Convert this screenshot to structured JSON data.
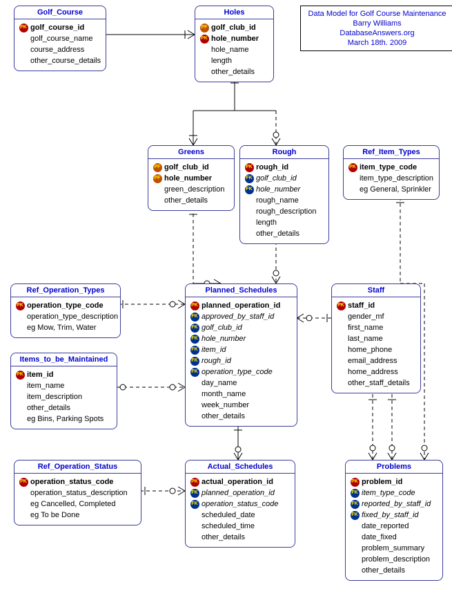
{
  "info": {
    "line1": "Data Model for Golf Course Maintenance",
    "line2": "Barry Williams",
    "line3": "DatabaseAnswers.org",
    "line4": "March 18th. 2009"
  },
  "entities": {
    "golf_course": {
      "title": "Golf_Course",
      "attrs": [
        {
          "key": "PK",
          "name": "golf_course_id",
          "bold": true
        },
        {
          "key": "",
          "name": "golf_course_name"
        },
        {
          "key": "",
          "name": "course_address"
        },
        {
          "key": "",
          "name": "other_course_details"
        }
      ]
    },
    "holes": {
      "title": "Holes",
      "attrs": [
        {
          "key": "PF",
          "name": "golf_club_id",
          "bold": true
        },
        {
          "key": "PK",
          "name": "hole_number",
          "bold": true
        },
        {
          "key": "",
          "name": "hole_name"
        },
        {
          "key": "",
          "name": "length"
        },
        {
          "key": "",
          "name": "other_details"
        }
      ]
    },
    "greens": {
      "title": "Greens",
      "attrs": [
        {
          "key": "PF",
          "name": "golf_club_id",
          "bold": true
        },
        {
          "key": "PF",
          "name": "hole_number",
          "bold": true
        },
        {
          "key": "",
          "name": "green_description"
        },
        {
          "key": "",
          "name": "other_details"
        }
      ]
    },
    "rough": {
      "title": "Rough",
      "attrs": [
        {
          "key": "PK",
          "name": "rough_id",
          "bold": true
        },
        {
          "key": "FK",
          "name": "golf_club_id",
          "italic": true
        },
        {
          "key": "FK",
          "name": "hole_number",
          "italic": true
        },
        {
          "key": "",
          "name": "rough_name"
        },
        {
          "key": "",
          "name": "rough_description"
        },
        {
          "key": "",
          "name": "length"
        },
        {
          "key": "",
          "name": "other_details"
        }
      ]
    },
    "ref_item_types": {
      "title": "Ref_Item_Types",
      "attrs": [
        {
          "key": "PK",
          "name": "item_type_code",
          "bold": true
        },
        {
          "key": "",
          "name": "item_type_description"
        },
        {
          "key": "",
          "name": "eg General, Sprinkler"
        }
      ]
    },
    "ref_operation_types": {
      "title": "Ref_Operation_Types",
      "attrs": [
        {
          "key": "PK",
          "name": "operation_type_code",
          "bold": true
        },
        {
          "key": "",
          "name": "operation_type_description"
        },
        {
          "key": "",
          "name": "eg Mow, Trim, Water"
        }
      ]
    },
    "items_to_be_maintained": {
      "title": "Items_to_be_Maintained",
      "attrs": [
        {
          "key": "PK",
          "name": "item_id",
          "bold": true
        },
        {
          "key": "",
          "name": "item_name"
        },
        {
          "key": "",
          "name": "item_description"
        },
        {
          "key": "",
          "name": "other_details"
        },
        {
          "key": "",
          "name": "eg Bins, Parking Spots"
        }
      ]
    },
    "planned_schedules": {
      "title": "Planned_Schedules",
      "attrs": [
        {
          "key": "PK",
          "name": "planned_operation_id",
          "bold": true
        },
        {
          "key": "FK",
          "name": "approved_by_staff_id",
          "italic": true
        },
        {
          "key": "FK",
          "name": "golf_club_id",
          "italic": true
        },
        {
          "key": "FK",
          "name": "hole_number",
          "italic": true
        },
        {
          "key": "FK",
          "name": "item_id",
          "italic": true
        },
        {
          "key": "FK",
          "name": "rough_id",
          "italic": true
        },
        {
          "key": "FK",
          "name": "operation_type_code",
          "italic": true
        },
        {
          "key": "",
          "name": "day_name"
        },
        {
          "key": "",
          "name": "month_name"
        },
        {
          "key": "",
          "name": "week_number"
        },
        {
          "key": "",
          "name": "other_details"
        }
      ]
    },
    "staff": {
      "title": "Staff",
      "attrs": [
        {
          "key": "PK",
          "name": "staff_id",
          "bold": true
        },
        {
          "key": "",
          "name": "gender_mf"
        },
        {
          "key": "",
          "name": "first_name"
        },
        {
          "key": "",
          "name": "last_name"
        },
        {
          "key": "",
          "name": "home_phone"
        },
        {
          "key": "",
          "name": "email_address"
        },
        {
          "key": "",
          "name": "home_address"
        },
        {
          "key": "",
          "name": "other_staff_details"
        }
      ]
    },
    "ref_operation_status": {
      "title": "Ref_Operation_Status",
      "attrs": [
        {
          "key": "PK",
          "name": "operation_status_code",
          "bold": true
        },
        {
          "key": "",
          "name": "operation_status_description"
        },
        {
          "key": "",
          "name": "eg Cancelled, Completed"
        },
        {
          "key": "",
          "name": "eg To be Done"
        }
      ]
    },
    "actual_schedules": {
      "title": "Actual_Schedules",
      "attrs": [
        {
          "key": "PK",
          "name": "actual_operation_id",
          "bold": true
        },
        {
          "key": "FK",
          "name": "planned_operation_id",
          "italic": true
        },
        {
          "key": "FK",
          "name": "operation_status_code",
          "italic": true
        },
        {
          "key": "",
          "name": "scheduled_date"
        },
        {
          "key": "",
          "name": "scheduled_time"
        },
        {
          "key": "",
          "name": "other_details"
        }
      ]
    },
    "problems": {
      "title": "Problems",
      "attrs": [
        {
          "key": "PK",
          "name": "problem_id",
          "bold": true
        },
        {
          "key": "FK",
          "name": "item_type_code",
          "italic": true
        },
        {
          "key": "FK",
          "name": "reported_by_staff_id",
          "italic": true
        },
        {
          "key": "FK",
          "name": "fixed_by_staff_id",
          "italic": true
        },
        {
          "key": "",
          "name": "date_reported"
        },
        {
          "key": "",
          "name": "date_fixed"
        },
        {
          "key": "",
          "name": "problem_summary"
        },
        {
          "key": "",
          "name": "problem_description"
        },
        {
          "key": "",
          "name": "other_details"
        }
      ]
    }
  }
}
